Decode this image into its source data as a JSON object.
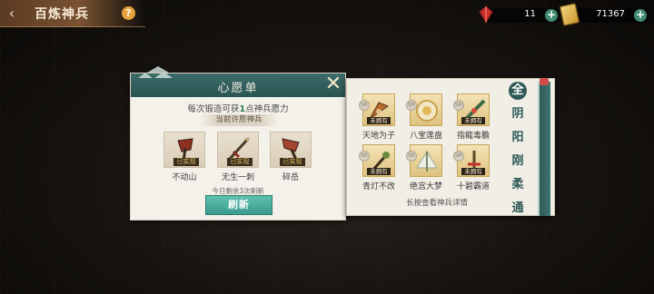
{
  "header": {
    "title": "百炼神兵",
    "back_icon": "back-arrow-icon",
    "help_label": "?"
  },
  "currencies": [
    {
      "name": "red-gem",
      "value": "11",
      "plus": "+"
    },
    {
      "name": "gold-ticket",
      "value": "71367",
      "plus": "+"
    }
  ],
  "wish_panel": {
    "title": "心愿单",
    "close_label": "✕",
    "desc_pre": "每次锻造可获",
    "desc_num": "1",
    "desc_post": "点神兵愿力",
    "current_label": "当前许愿神兵",
    "items": [
      {
        "name": "不动山",
        "status": "已实现"
      },
      {
        "name": "无生一刺",
        "status": "已实现"
      },
      {
        "name": "碎岳",
        "status": "已实现"
      }
    ],
    "remaining_text": "今日剩余3次刷新",
    "refresh_label": "刷新"
  },
  "weapon_panel": {
    "rows": [
      [
        {
          "name": "天地为子",
          "owned": "未拥有",
          "grade": "SR"
        },
        {
          "name": "八宝莲盘",
          "owned": "",
          "grade": "SR"
        },
        {
          "name": "指龍毒膽",
          "owned": "未拥有",
          "grade": "SR"
        }
      ],
      [
        {
          "name": "青灯不改",
          "owned": "未拥有",
          "grade": "SR"
        },
        {
          "name": "绝宫大梦",
          "owned": "",
          "grade": "SR"
        },
        {
          "name": "十碧霸道",
          "owned": "未拥有",
          "grade": "SR"
        }
      ]
    ],
    "hint": "长按查看神兵详情"
  },
  "filters": [
    "全",
    "阴",
    "阳",
    "刚",
    "柔",
    "通"
  ]
}
